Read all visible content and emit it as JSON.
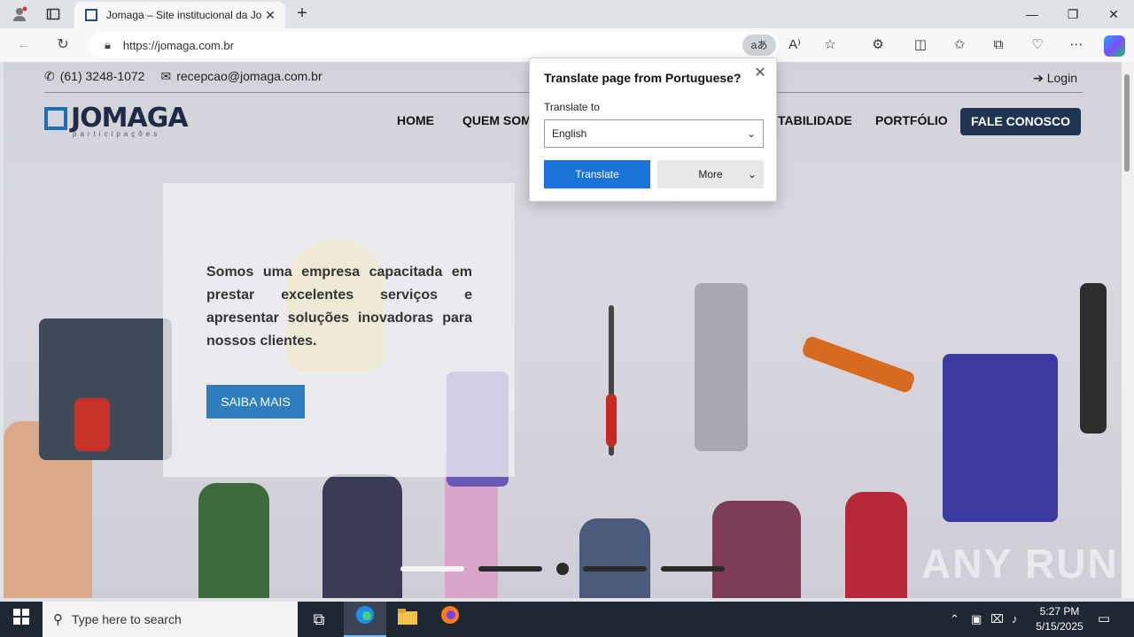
{
  "browser": {
    "tab_title": "Jomaga – Site institucional da Jor",
    "url": "https://jomaga.com.br",
    "translate_chip": "aあ",
    "icons": {
      "profile": "profile-icon",
      "tab_actions": "tab-actions-icon",
      "back": "back-arrow-icon",
      "refresh": "refresh-icon",
      "lock": "lock-icon"
    }
  },
  "site": {
    "phone": "(61) 3248-1072",
    "email": "recepcao@jomaga.com.br",
    "login": "Login",
    "logo_word": "JOMAGA",
    "logo_sub": "participações",
    "menu": {
      "home": "HOME",
      "quem_somos": "QUEM SOM",
      "sustentabilidade": "TABILIDADE",
      "portfolio": "PORTFÓLIO"
    },
    "cta": "FALE CONOSCO",
    "hero_text": "Somos uma empresa capacitada em prestar excelentes serviços e apresentar soluções inovadoras para nossos clientes.",
    "hero_button": "SAIBA MAIS",
    "watermark": "ANY RUN"
  },
  "translate_popup": {
    "title": "Translate page from Portuguese?",
    "label": "Translate to",
    "selected_language": "English",
    "translate_button": "Translate",
    "more_button": "More"
  },
  "taskbar": {
    "search_placeholder": "Type here to search",
    "time": "5:27 PM",
    "date": "5/15/2025"
  }
}
